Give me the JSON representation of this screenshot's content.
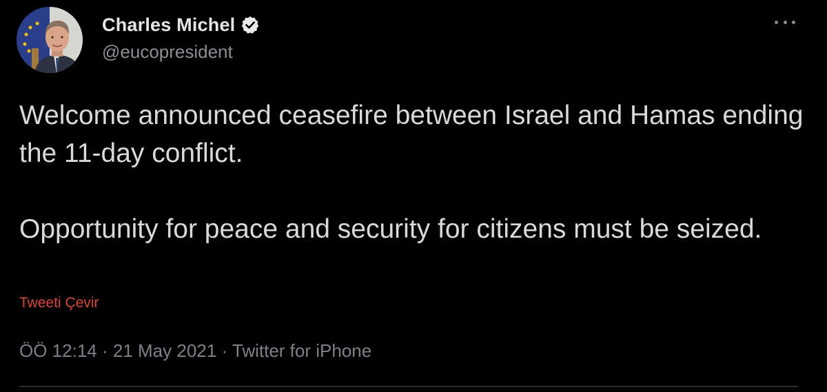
{
  "author": {
    "display_name": "Charles Michel",
    "handle": "@eucopresident",
    "verified": true,
    "avatar_icon": "profile-photo"
  },
  "tweet": {
    "paragraphs": [
      "Welcome announced ceasefire between Israel and Hamas ending the 11-day conflict.",
      "Opportunity for peace and security for citizens must be seized."
    ],
    "translate_label": "Tweeti Çevir"
  },
  "meta": {
    "time": "ÖÖ 12:14",
    "separator": "·",
    "date": "21 May 2021",
    "source": "Twitter for iPhone"
  },
  "colors": {
    "background": "#000000",
    "text": "#d9d9d9",
    "muted": "#7d8186",
    "link": "#d8483c",
    "divider": "#2a2d31"
  }
}
